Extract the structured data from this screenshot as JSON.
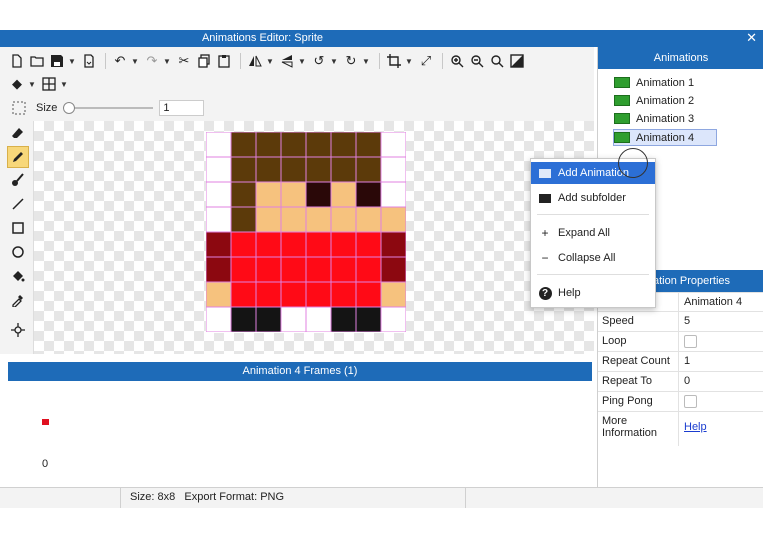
{
  "window": {
    "title": "Animations Editor: Sprite",
    "close_glyph": "✕"
  },
  "toolbar": {
    "size_label": "Size",
    "size_value": "1",
    "size_fraction": 0.0
  },
  "sprite": {
    "palette": {
      "h": "#5c3a0a",
      "s": "#f6c27e",
      "e": "#2a0808",
      "r": "#ff0a16",
      "d": "#8c0810",
      "b": "#141414",
      "w": "#ffffff"
    },
    "rows": [
      "whhhhhhw",
      "whhhhhhw",
      "whssesew",
      "whssssssw",
      "drrrrrrd",
      "drrrrrrd",
      "srrrrrrs",
      "wbbbbbbw",
      "wbbwwbbw"
    ]
  },
  "frames": {
    "header": "Animation 4 Frames (1)",
    "frame_index": "0"
  },
  "status": {
    "text": "Size: 8x8   Export Format: PNG"
  },
  "animations": {
    "header": "Animations",
    "items": [
      {
        "label": "Animation 1",
        "selected": false
      },
      {
        "label": "Animation 2",
        "selected": false
      },
      {
        "label": "Animation 3",
        "selected": false
      },
      {
        "label": "Animation 4",
        "selected": true
      }
    ]
  },
  "context_menu": {
    "items": [
      {
        "label": "Add Animation",
        "icon": "film-icon",
        "highlighted": true
      },
      {
        "label": "Add subfolder",
        "icon": "folder-add-icon",
        "highlighted": false
      },
      {
        "label": "Expand All",
        "icon": "plus-icon",
        "highlighted": false
      },
      {
        "label": "Collapse All",
        "icon": "minus-icon",
        "highlighted": false
      },
      {
        "label": "Help",
        "icon": "help-icon",
        "highlighted": false
      }
    ]
  },
  "properties": {
    "header": "ation Properties",
    "name_value": "Animation 4",
    "rows": [
      {
        "key": "Speed",
        "value": "5"
      },
      {
        "key": "Loop",
        "value": ""
      },
      {
        "key": "Repeat Count",
        "value": "1"
      },
      {
        "key": "Repeat To",
        "value": "0"
      },
      {
        "key": "Ping Pong",
        "value": ""
      },
      {
        "key": "More Information",
        "value": "Help"
      }
    ]
  }
}
